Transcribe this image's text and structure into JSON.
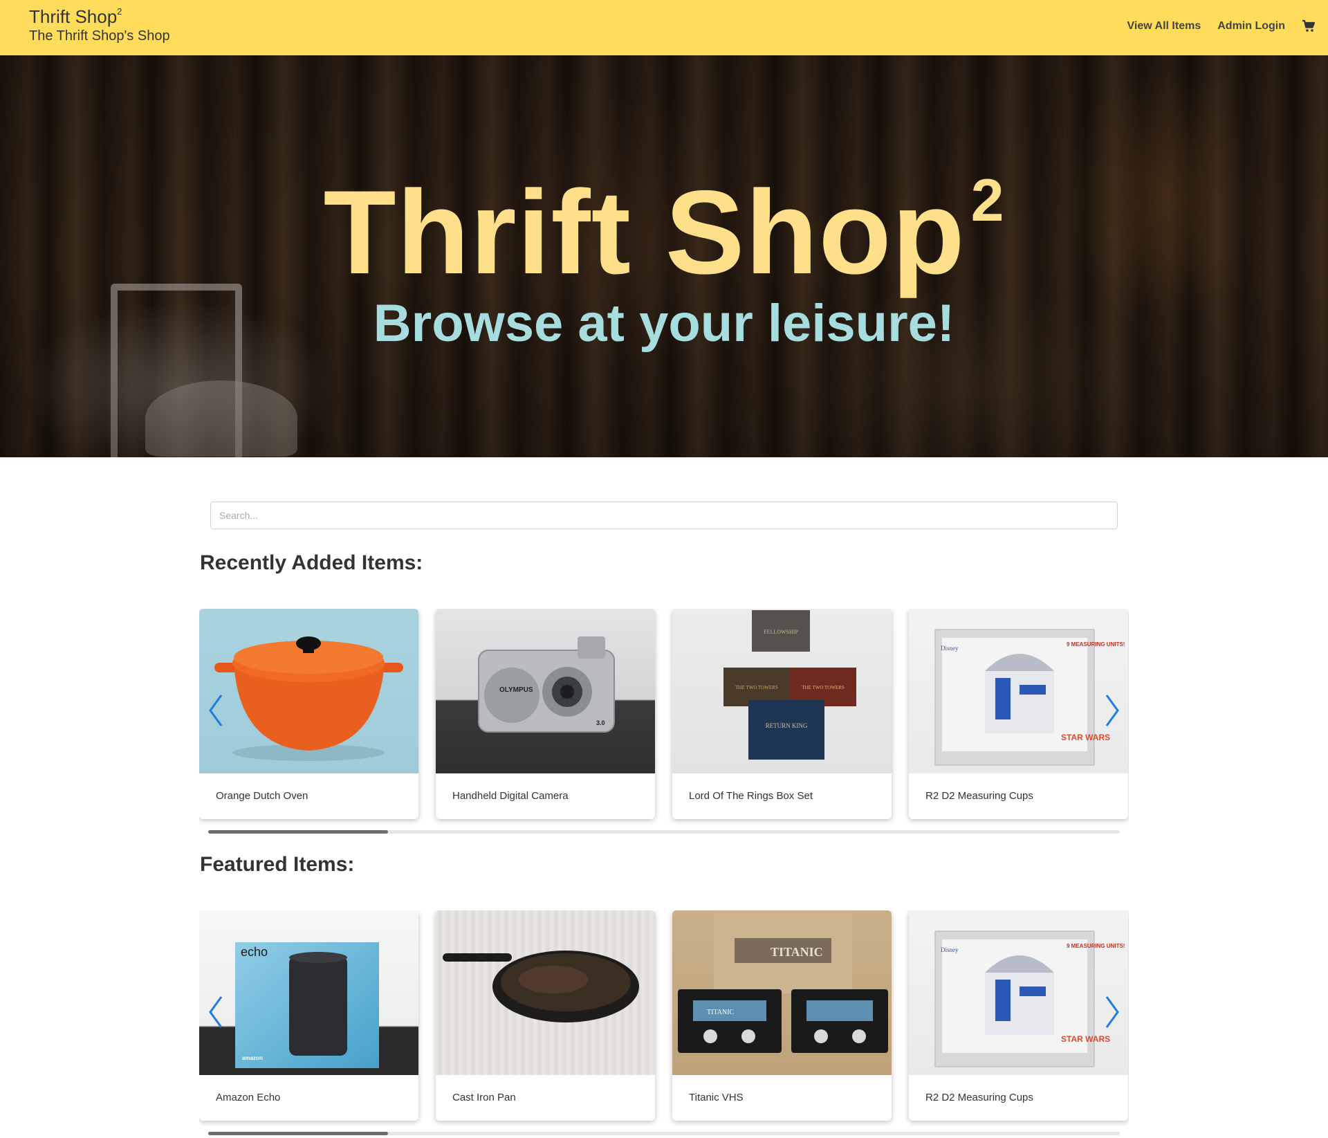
{
  "navbar": {
    "brand_title": "Thrift Shop",
    "brand_superscript": "2",
    "brand_subtitle": "The Thrift Shop's Shop",
    "links": [
      "View All Items",
      "Admin Login"
    ],
    "cart_icon": "shopping-cart-icon",
    "background_color": "#ffdc5a"
  },
  "hero": {
    "title": "Thrift Shop",
    "title_superscript": "2",
    "subtitle": "Browse at your leisure!",
    "title_color": "#ffe08a",
    "subtitle_color": "#a8dde0"
  },
  "search": {
    "placeholder": "Search..."
  },
  "recent": {
    "heading": "Recently Added Items:",
    "items": [
      "Orange Dutch Oven",
      "Handheld Digital Camera",
      "Lord Of The Rings Box Set",
      "R2 D2 Measuring Cups"
    ]
  },
  "featured": {
    "heading": "Featured Items:",
    "items": [
      "Amazon Echo",
      "Cast Iron Pan",
      "Titanic VHS",
      "R2 D2 Measuring Cups"
    ]
  },
  "photo_text": {
    "camera_brand": "OLYMPUS",
    "camera_zoom": "3.0",
    "lotr_top": "FELLOWSHIP",
    "lotr_left": "THE TWO TOWERS",
    "lotr_right": "THE TWO TOWERS",
    "lotr_bottom": "RETURN KING",
    "r2_banner": "STAR WARS",
    "r2_units": "9 MEASURING UNITS!",
    "r2_disney": "Disney",
    "echo_label": "echo",
    "echo_brand": "amazon",
    "titanic_box": "TITANIC",
    "titanic_tape": "TITANIC"
  },
  "accent_color": "#1e7be0"
}
